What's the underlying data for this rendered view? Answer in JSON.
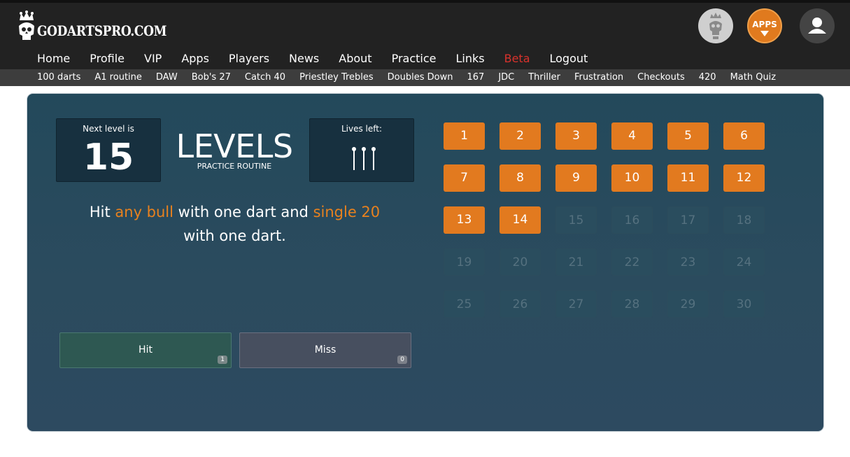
{
  "header": {
    "logo_text": "GODARTSPRO.COM",
    "apps_label": "APPS",
    "nav": [
      "Home",
      "Profile",
      "VIP",
      "Apps",
      "Players",
      "News",
      "About",
      "Practice",
      "Links",
      "Beta",
      "Logout"
    ],
    "subnav": [
      "100 darts",
      "A1 routine",
      "DAW",
      "Bob's 27",
      "Catch 40",
      "Priestley Trebles",
      "Doubles Down",
      "167",
      "JDC",
      "Thriller",
      "Frustration",
      "Checkouts",
      "420",
      "Math Quiz"
    ]
  },
  "routine": {
    "next_label": "Next level is",
    "next_value": "15",
    "title": "LEVELS",
    "subtitle": "PRACTICE ROUTINE",
    "lives_label": "Lives left:",
    "lives_count": 3,
    "instruction": {
      "p1": "Hit ",
      "h1": "any bull",
      "p2": " with one dart and ",
      "h2": "single 20",
      "p3": "with one dart."
    },
    "hit_label": "Hit",
    "hit_count": "1",
    "miss_label": "Miss",
    "miss_count": "0"
  },
  "levels": {
    "completed": 14,
    "items": [
      "1",
      "2",
      "3",
      "4",
      "5",
      "6",
      "7",
      "8",
      "9",
      "10",
      "11",
      "12",
      "13",
      "14",
      "15",
      "16",
      "17",
      "18",
      "19",
      "20",
      "21",
      "22",
      "23",
      "24",
      "25",
      "26",
      "27",
      "28",
      "29",
      "30"
    ]
  },
  "colors": {
    "accent": "#e27a1f",
    "beta": "#d9322c",
    "panel": "#23495b"
  }
}
